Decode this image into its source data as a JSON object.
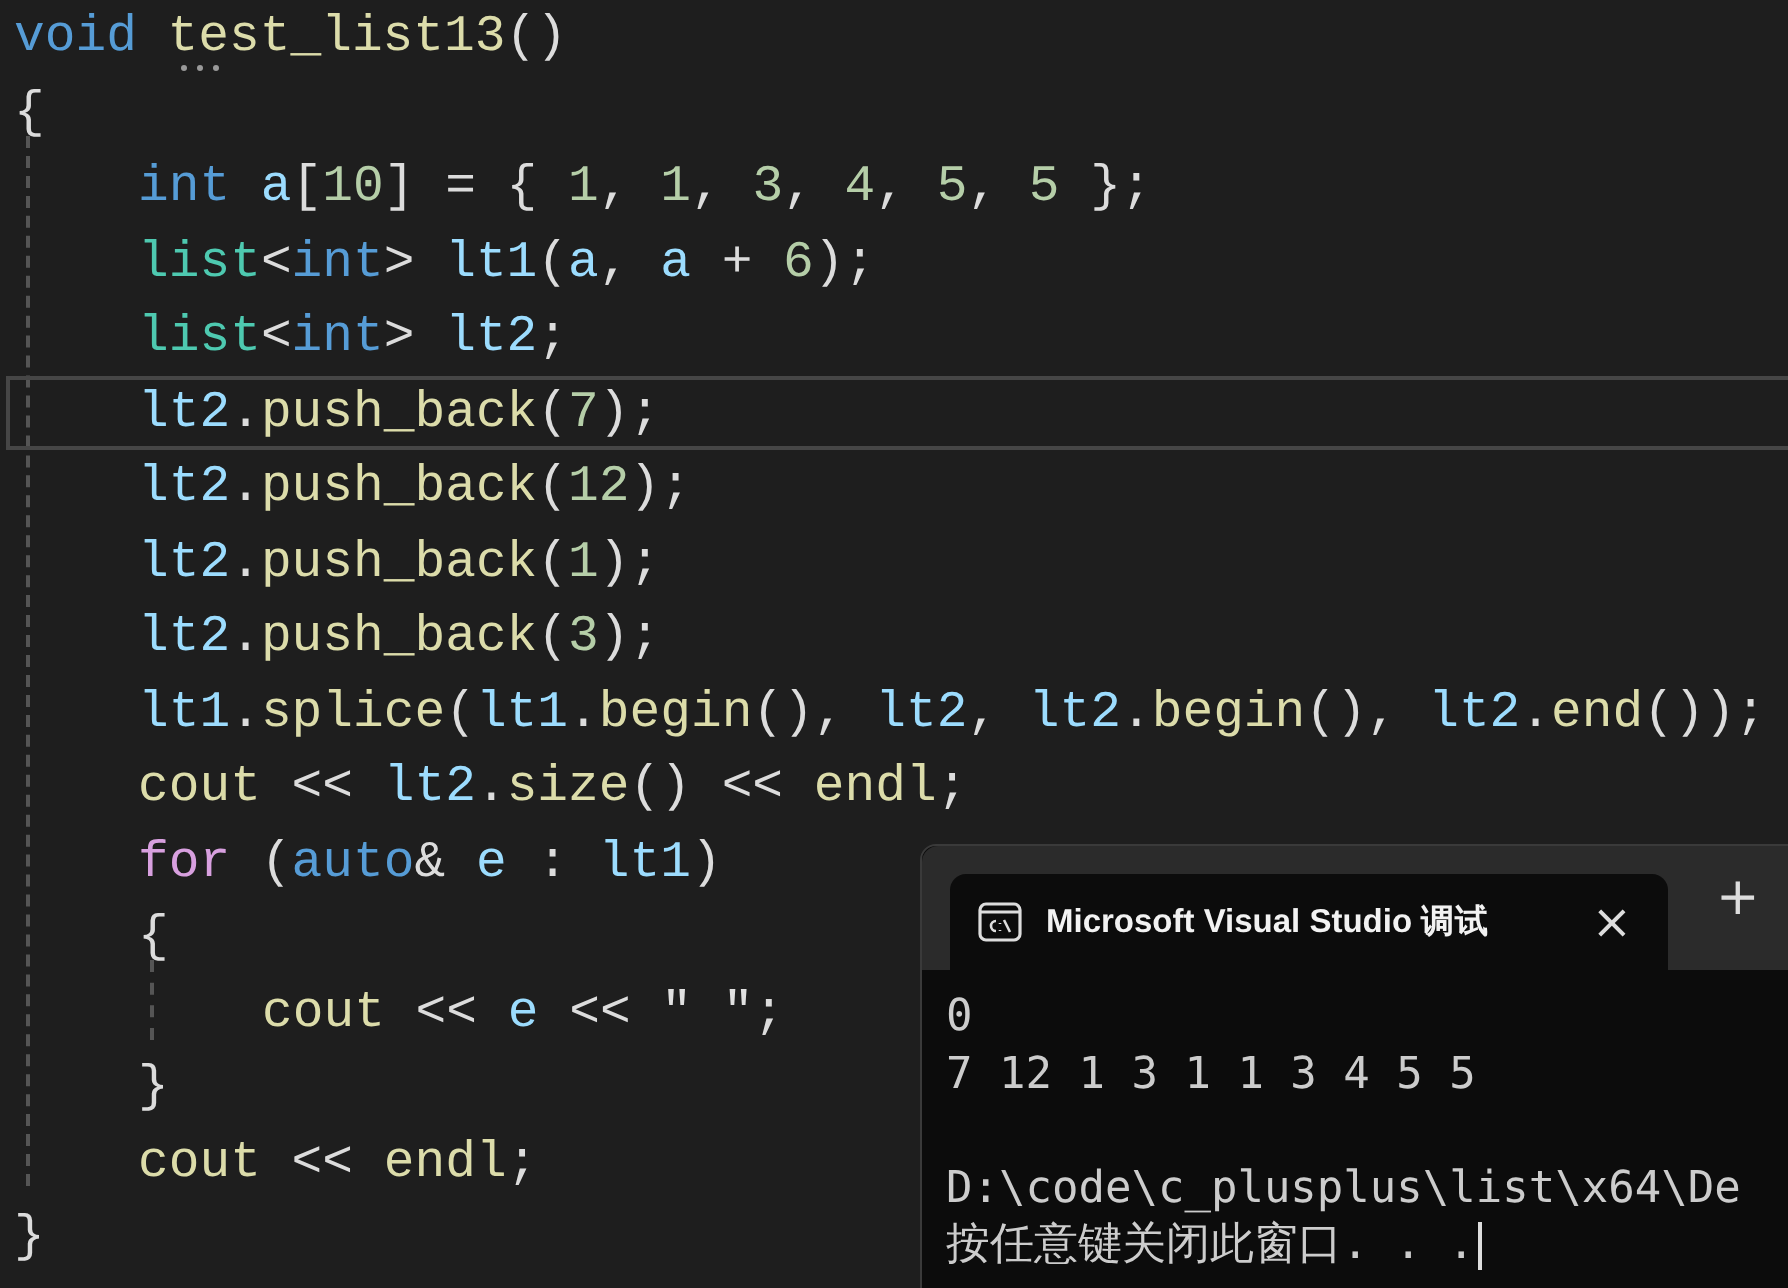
{
  "editor": {
    "lines": [
      {
        "current": false,
        "tokens": [
          {
            "kind": "keyword",
            "text": "void"
          },
          {
            "kind": "func",
            "text": " test_list13"
          },
          {
            "kind": "plain",
            "text": "()"
          }
        ]
      },
      {
        "current": false,
        "tokens": [
          {
            "kind": "plain",
            "text": "{"
          }
        ],
        "children": [
          {
            "current": false,
            "tokens": [
              {
                "kind": "keyword",
                "text": "int"
              },
              {
                "kind": "ident",
                "text": " a"
              },
              {
                "kind": "plain",
                "text": "["
              },
              {
                "kind": "number",
                "text": "10"
              },
              {
                "kind": "plain",
                "text": "] = { "
              },
              {
                "kind": "number",
                "text": "1"
              },
              {
                "kind": "plain",
                "text": ", "
              },
              {
                "kind": "number",
                "text": "1"
              },
              {
                "kind": "plain",
                "text": ", "
              },
              {
                "kind": "number",
                "text": "3"
              },
              {
                "kind": "plain",
                "text": ", "
              },
              {
                "kind": "number",
                "text": "4"
              },
              {
                "kind": "plain",
                "text": ", "
              },
              {
                "kind": "number",
                "text": "5"
              },
              {
                "kind": "plain",
                "text": ", "
              },
              {
                "kind": "number",
                "text": "5"
              },
              {
                "kind": "plain",
                "text": " };"
              }
            ]
          },
          {
            "current": false,
            "tokens": [
              {
                "kind": "type",
                "text": "list"
              },
              {
                "kind": "plain",
                "text": "<"
              },
              {
                "kind": "keyword",
                "text": "int"
              },
              {
                "kind": "plain",
                "text": ">"
              },
              {
                "kind": "ident",
                "text": " lt1"
              },
              {
                "kind": "plain",
                "text": "("
              },
              {
                "kind": "ident",
                "text": "a"
              },
              {
                "kind": "plain",
                "text": ", "
              },
              {
                "kind": "ident",
                "text": "a"
              },
              {
                "kind": "plain",
                "text": " + "
              },
              {
                "kind": "number",
                "text": "6"
              },
              {
                "kind": "plain",
                "text": ");"
              }
            ]
          },
          {
            "current": false,
            "tokens": [
              {
                "kind": "type",
                "text": "list"
              },
              {
                "kind": "plain",
                "text": "<"
              },
              {
                "kind": "keyword",
                "text": "int"
              },
              {
                "kind": "plain",
                "text": ">"
              },
              {
                "kind": "ident",
                "text": " lt2"
              },
              {
                "kind": "plain",
                "text": ";"
              }
            ]
          },
          {
            "current": true,
            "tokens": [
              {
                "kind": "ident",
                "text": "lt2"
              },
              {
                "kind": "plain",
                "text": "."
              },
              {
                "kind": "func",
                "text": "push_back"
              },
              {
                "kind": "plain",
                "text": "("
              },
              {
                "kind": "number",
                "text": "7"
              },
              {
                "kind": "plain",
                "text": ");"
              }
            ]
          },
          {
            "current": false,
            "tokens": [
              {
                "kind": "ident",
                "text": "lt2"
              },
              {
                "kind": "plain",
                "text": "."
              },
              {
                "kind": "func",
                "text": "push_back"
              },
              {
                "kind": "plain",
                "text": "("
              },
              {
                "kind": "number",
                "text": "12"
              },
              {
                "kind": "plain",
                "text": ");"
              }
            ]
          },
          {
            "current": false,
            "tokens": [
              {
                "kind": "ident",
                "text": "lt2"
              },
              {
                "kind": "plain",
                "text": "."
              },
              {
                "kind": "func",
                "text": "push_back"
              },
              {
                "kind": "plain",
                "text": "("
              },
              {
                "kind": "number",
                "text": "1"
              },
              {
                "kind": "plain",
                "text": ");"
              }
            ]
          },
          {
            "current": false,
            "tokens": [
              {
                "kind": "ident",
                "text": "lt2"
              },
              {
                "kind": "plain",
                "text": "."
              },
              {
                "kind": "func",
                "text": "push_back"
              },
              {
                "kind": "plain",
                "text": "("
              },
              {
                "kind": "number",
                "text": "3"
              },
              {
                "kind": "plain",
                "text": ");"
              }
            ]
          },
          {
            "current": false,
            "tokens": [
              {
                "kind": "ident",
                "text": "lt1"
              },
              {
                "kind": "plain",
                "text": "."
              },
              {
                "kind": "func",
                "text": "splice"
              },
              {
                "kind": "plain",
                "text": "("
              },
              {
                "kind": "ident",
                "text": "lt1"
              },
              {
                "kind": "plain",
                "text": "."
              },
              {
                "kind": "func",
                "text": "begin"
              },
              {
                "kind": "plain",
                "text": "(), "
              },
              {
                "kind": "ident",
                "text": "lt2"
              },
              {
                "kind": "plain",
                "text": ", "
              },
              {
                "kind": "ident",
                "text": "lt2"
              },
              {
                "kind": "plain",
                "text": "."
              },
              {
                "kind": "func",
                "text": "begin"
              },
              {
                "kind": "plain",
                "text": "(), "
              },
              {
                "kind": "ident",
                "text": "lt2"
              },
              {
                "kind": "plain",
                "text": "."
              },
              {
                "kind": "func",
                "text": "end"
              },
              {
                "kind": "plain",
                "text": "());"
              }
            ]
          },
          {
            "current": false,
            "tokens": [
              {
                "kind": "func",
                "text": "cout"
              },
              {
                "kind": "plain",
                "text": " << "
              },
              {
                "kind": "ident",
                "text": "lt2"
              },
              {
                "kind": "plain",
                "text": "."
              },
              {
                "kind": "func",
                "text": "size"
              },
              {
                "kind": "plain",
                "text": "() << "
              },
              {
                "kind": "func",
                "text": "endl"
              },
              {
                "kind": "plain",
                "text": ";"
              }
            ]
          },
          {
            "current": false,
            "tokens": [
              {
                "kind": "control",
                "text": "for"
              },
              {
                "kind": "plain",
                "text": " ("
              },
              {
                "kind": "keyword",
                "text": "auto"
              },
              {
                "kind": "plain",
                "text": "& "
              },
              {
                "kind": "ident",
                "text": "e"
              },
              {
                "kind": "plain",
                "text": " : "
              },
              {
                "kind": "ident",
                "text": "lt1"
              },
              {
                "kind": "plain",
                "text": ")"
              }
            ]
          },
          {
            "current": false,
            "tokens": [
              {
                "kind": "plain",
                "text": "{"
              }
            ],
            "children": [
              {
                "current": false,
                "tokens": [
                  {
                    "kind": "func",
                    "text": "cout"
                  },
                  {
                    "kind": "plain",
                    "text": " << "
                  },
                  {
                    "kind": "ident",
                    "text": "e"
                  },
                  {
                    "kind": "plain",
                    "text": " << "
                  },
                  {
                    "kind": "string",
                    "text": "\" \""
                  },
                  {
                    "kind": "plain",
                    "text": ";"
                  }
                ]
              }
            ]
          },
          {
            "current": false,
            "tokens": [
              {
                "kind": "plain",
                "text": "}"
              }
            ]
          },
          {
            "current": false,
            "tokens": [
              {
                "kind": "func",
                "text": "cout"
              },
              {
                "kind": "plain",
                "text": " << "
              },
              {
                "kind": "func",
                "text": "endl"
              },
              {
                "kind": "plain",
                "text": ";"
              }
            ]
          }
        ]
      },
      {
        "current": false,
        "tokens": [
          {
            "kind": "plain",
            "text": "}"
          }
        ]
      }
    ]
  },
  "terminal": {
    "tab": {
      "title": "Microsoft Visual Studio 调试",
      "close": "×"
    },
    "new_tab": "+",
    "output": [
      {
        "text": "0",
        "gap_before": false
      },
      {
        "text": "7 12 1 3 1 1 3 4 5 5",
        "gap_before": false
      },
      {
        "text": "D:\\code\\c_plusplus\\list\\x64\\De",
        "gap_before": true
      },
      {
        "text": "按任意键关闭此窗口. . .",
        "gap_before": false
      }
    ]
  }
}
